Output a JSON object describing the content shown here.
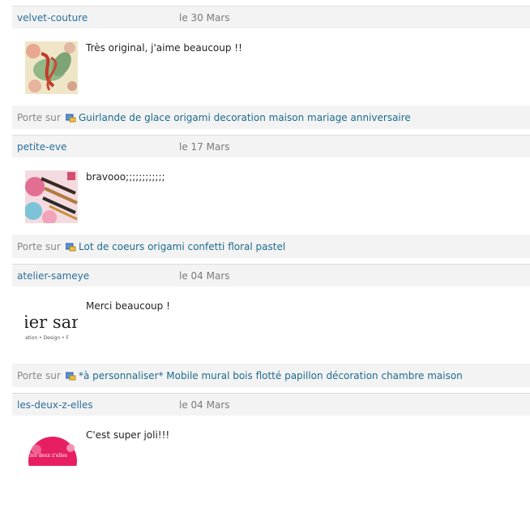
{
  "comments": [
    {
      "author": "velvet-couture",
      "date": "le 30 Mars",
      "text": "Très original, j'aime beaucoup !!",
      "avatar_text": "",
      "footer_prefix": "Porte sur",
      "product_link": "Guirlande de glace origami decoration maison mariage anniversaire"
    },
    {
      "author": "petite-eve",
      "date": "le 17 Mars",
      "text": "bravooo;;;;;;;;;;;;",
      "avatar_text": "",
      "footer_prefix": "Porte sur",
      "product_link": "Lot de coeurs origami confetti floral pastel"
    },
    {
      "author": "atelier-sameye",
      "date": "le 04 Mars",
      "text": "Merci beaucoup !",
      "avatar_text": "ier san",
      "avatar_subtext": "ation • Design • F",
      "footer_prefix": "Porte sur",
      "product_link": "*à personnaliser* Mobile mural bois flotté papillon décoration chambre maison"
    },
    {
      "author": "les-deux-z-elles",
      "date": "le 04 Mars",
      "text": "C'est super joli!!!",
      "avatar_text": "les deux z'elles",
      "footer_prefix": "",
      "product_link": ""
    }
  ],
  "colors": {
    "author": "#2a6f9b",
    "link": "#1d6b8f",
    "header_bg": "#f3f3f3"
  },
  "icons": {
    "product_icon": "product-gift-icon"
  }
}
